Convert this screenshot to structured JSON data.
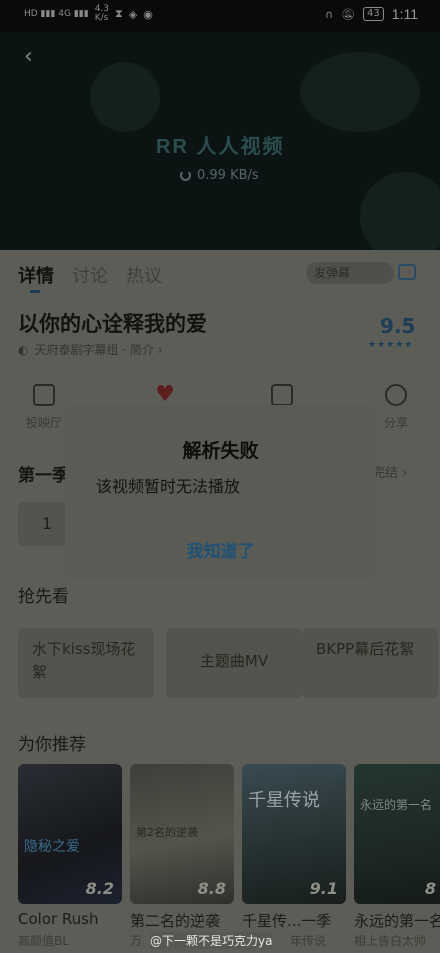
{
  "status_bar": {
    "left_text": "HD 4G 46 4.3 K/s",
    "speed": "4.3",
    "speed_unit": "K/s",
    "battery": "43",
    "time": "1:11"
  },
  "player": {
    "logo_text": "人人视频",
    "logo_mark": "RR",
    "speed_text": "0.99 KB/s"
  },
  "tabs": [
    "详情",
    "讨论",
    "热议"
  ],
  "danmu_placeholder": "发弹幕",
  "show": {
    "title": "以你的心诠释我的爱",
    "subtitle": "天府泰剧字幕组 · 简介 ›",
    "score": "9.5",
    "stars": "★★★★★"
  },
  "actions": {
    "player_label": "投映厅",
    "share_label": "分享"
  },
  "season": {
    "label": "第一季",
    "more": "完结 ›",
    "episode": "1"
  },
  "preview": {
    "section_title": "抢先看",
    "items": [
      "水下kiss现场花絮",
      "主题曲MV",
      "BKPP幕后花絮"
    ]
  },
  "recommend": {
    "section_title": "为你推荐",
    "items": [
      {
        "name": "Color Rush",
        "sub": "高颜值BL",
        "score": "8.2"
      },
      {
        "name": "第二名的逆袭",
        "sub": "万",
        "score": "8.8"
      },
      {
        "name": "千星传...一季",
        "sub": "年传说",
        "score": "9.1"
      },
      {
        "name": "永远的第一名",
        "sub": "相上告白太帅",
        "score": "8"
      }
    ]
  },
  "watermark": "@下一颗不是巧克力ya",
  "dialog": {
    "title": "解析失败",
    "message": "该视频暂时无法播放",
    "button": "我知道了"
  }
}
